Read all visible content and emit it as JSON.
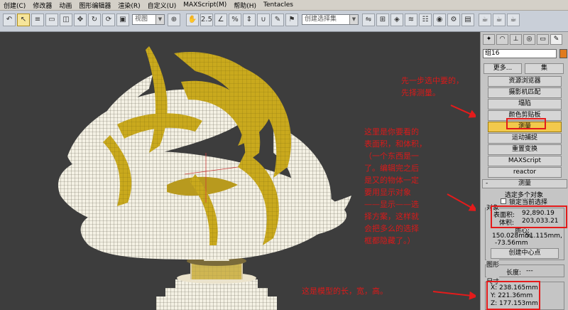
{
  "menu": [
    "创建(C)",
    "修改器",
    "动画",
    "图形编辑器",
    "渲染(R)",
    "自定义(U)",
    "MAXScript(M)",
    "帮助(H)",
    "Tentacles"
  ],
  "toolbar": {
    "view_select": "视图",
    "selection_set_placeholder": "创建选择集"
  },
  "panel": {
    "object_name": "组16",
    "utilities": {
      "more_button": "更多...",
      "sets_button": "集",
      "buttons": [
        "资源浏览器",
        "摄影机匹配",
        "塌陷",
        "颜色剪贴板",
        "测量",
        "运动捕捉",
        "重置变换",
        "MAXScript",
        "reactor"
      ],
      "active_button": "测量"
    },
    "measure": {
      "rollout_title": "测量",
      "rollout_toggle": "-",
      "selected": "选定多个对象",
      "lock_selection": "锁定当前选择",
      "objects_group": "对象",
      "surface_area_label": "表面积:",
      "surface_area": "92,890.19",
      "volume_label": "体积:",
      "volume": "203,033.21",
      "center_label": "质心:",
      "center": [
        "150.028mm,",
        "51.115mm,",
        "-73.56mm"
      ],
      "create_center_button": "创建中心点",
      "shapes_group": "图形",
      "length_label": "长度:",
      "length": "---",
      "dimensions_group": "尺寸",
      "dim_x": "X:  238.165mm",
      "dim_y": "Y:  221.36mm",
      "dim_z": "Z:  177.153mm"
    }
  },
  "annotations": {
    "note1": [
      "先一步选中要的，",
      "先择测量。"
    ],
    "note2": [
      "这里是你要看的",
      "表面积，和体积，",
      "（一个东西是一",
      "了。编辑完之后",
      "是又的物体一定",
      "要用显示对象",
      "——显示——选",
      "择方案，这样就",
      "会把多么的选择",
      "框都隐藏了。）"
    ],
    "note3": "这是模型的长，宽，高。"
  },
  "colors": {
    "sculpture_gold": "#c9a91d",
    "annotation_red": "#d91a1a",
    "active_button": "#f2c94c"
  }
}
